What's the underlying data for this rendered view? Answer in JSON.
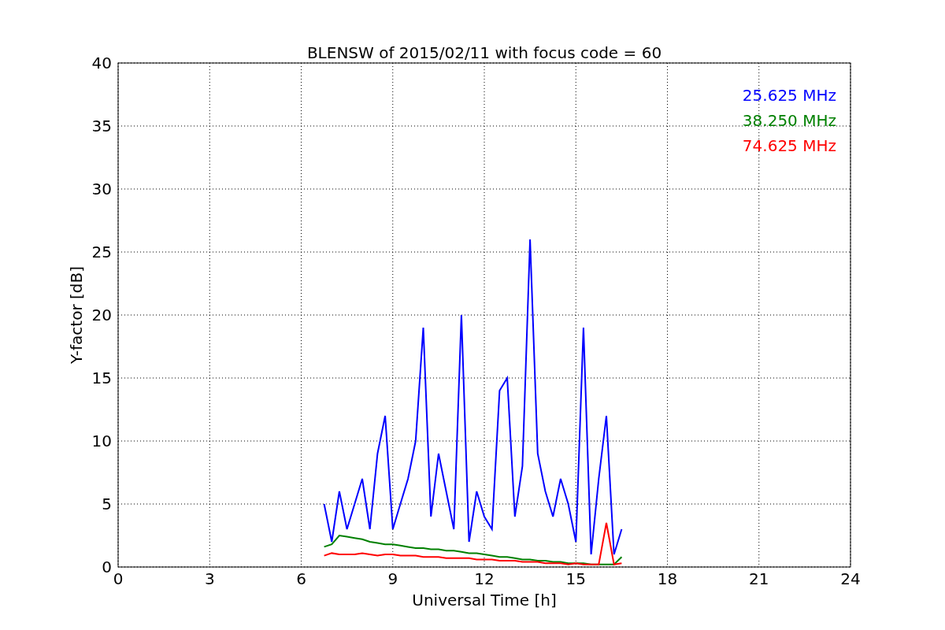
{
  "figure": {
    "chart_data": {
      "type": "line",
      "title": "BLENSW of 2015/02/11 with focus code = 60",
      "xlabel": "Universal Time [h]",
      "ylabel": "Y-factor [dB]",
      "x": [
        6.75,
        7.0,
        7.25,
        7.5,
        7.75,
        8.0,
        8.25,
        8.5,
        8.75,
        9.0,
        9.25,
        9.5,
        9.75,
        10.0,
        10.25,
        10.5,
        10.75,
        11.0,
        11.25,
        11.5,
        11.75,
        12.0,
        12.25,
        12.5,
        12.75,
        13.0,
        13.25,
        13.5,
        13.75,
        14.0,
        14.25,
        14.5,
        14.75,
        15.0,
        15.25,
        15.5,
        15.75,
        16.0,
        16.25,
        16.5
      ],
      "series": [
        {
          "name": "25.625 MHz",
          "color": "#0000ff",
          "values": [
            5,
            2,
            6,
            3,
            5,
            7,
            3,
            9,
            12,
            3,
            5,
            7,
            10,
            19,
            4,
            9,
            6,
            3,
            20,
            2,
            6,
            4,
            3,
            14,
            15,
            4,
            8,
            26,
            9,
            6,
            4,
            7,
            5,
            2,
            19,
            1,
            7,
            12,
            1,
            3
          ]
        },
        {
          "name": "38.250 MHz",
          "color": "#008000",
          "values": [
            1.6,
            1.8,
            2.5,
            2.4,
            2.3,
            2.2,
            2.0,
            1.9,
            1.8,
            1.8,
            1.7,
            1.6,
            1.5,
            1.5,
            1.4,
            1.4,
            1.3,
            1.3,
            1.2,
            1.1,
            1.1,
            1.0,
            0.9,
            0.8,
            0.8,
            0.7,
            0.6,
            0.6,
            0.5,
            0.5,
            0.4,
            0.4,
            0.3,
            0.3,
            0.3,
            0.2,
            0.2,
            0.2,
            0.2,
            0.8
          ]
        },
        {
          "name": "74.625 MHz",
          "color": "#ff0000",
          "values": [
            0.9,
            1.1,
            1.0,
            1.0,
            1.0,
            1.1,
            1.0,
            0.9,
            1.0,
            1.0,
            0.9,
            0.9,
            0.9,
            0.8,
            0.8,
            0.8,
            0.7,
            0.7,
            0.7,
            0.7,
            0.6,
            0.6,
            0.6,
            0.5,
            0.5,
            0.5,
            0.4,
            0.4,
            0.4,
            0.3,
            0.3,
            0.3,
            0.2,
            0.3,
            0.2,
            0.2,
            0.2,
            3.5,
            0.2,
            0.3
          ]
        }
      ],
      "xlim": [
        0,
        24
      ],
      "ylim": [
        0,
        40
      ],
      "xticks": [
        0,
        3,
        6,
        9,
        12,
        15,
        18,
        21,
        24
      ],
      "yticks": [
        0,
        5,
        10,
        15,
        20,
        25,
        30,
        35,
        40
      ],
      "grid": true
    }
  }
}
